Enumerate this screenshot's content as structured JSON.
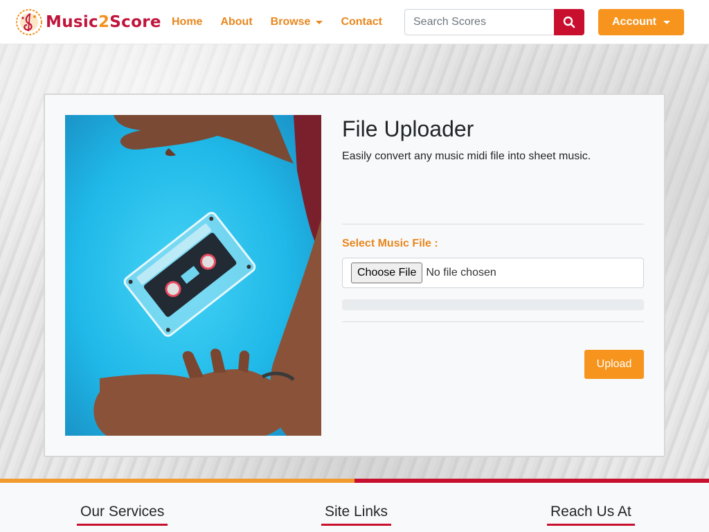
{
  "brand": {
    "part1": "Music",
    "part2": "2",
    "part3": "Score"
  },
  "nav": {
    "home": "Home",
    "about": "About",
    "browse": "Browse",
    "contact": "Contact"
  },
  "search": {
    "placeholder": "Search Scores",
    "icon": "search-icon"
  },
  "account": {
    "label": "Account"
  },
  "uploader": {
    "title": "File Uploader",
    "subtitle": "Easily convert any music midi file into sheet music.",
    "select_label": "Select Music File :",
    "choose_button": "Choose File",
    "file_status": "No file chosen",
    "progress": 0,
    "upload_button": "Upload"
  },
  "footer": {
    "services": "Our Services",
    "links": "Site Links",
    "reach": "Reach Us At"
  },
  "colors": {
    "accent_orange": "#f7941d",
    "brand_red": "#c8102e",
    "nav_text": "#e8871e"
  }
}
